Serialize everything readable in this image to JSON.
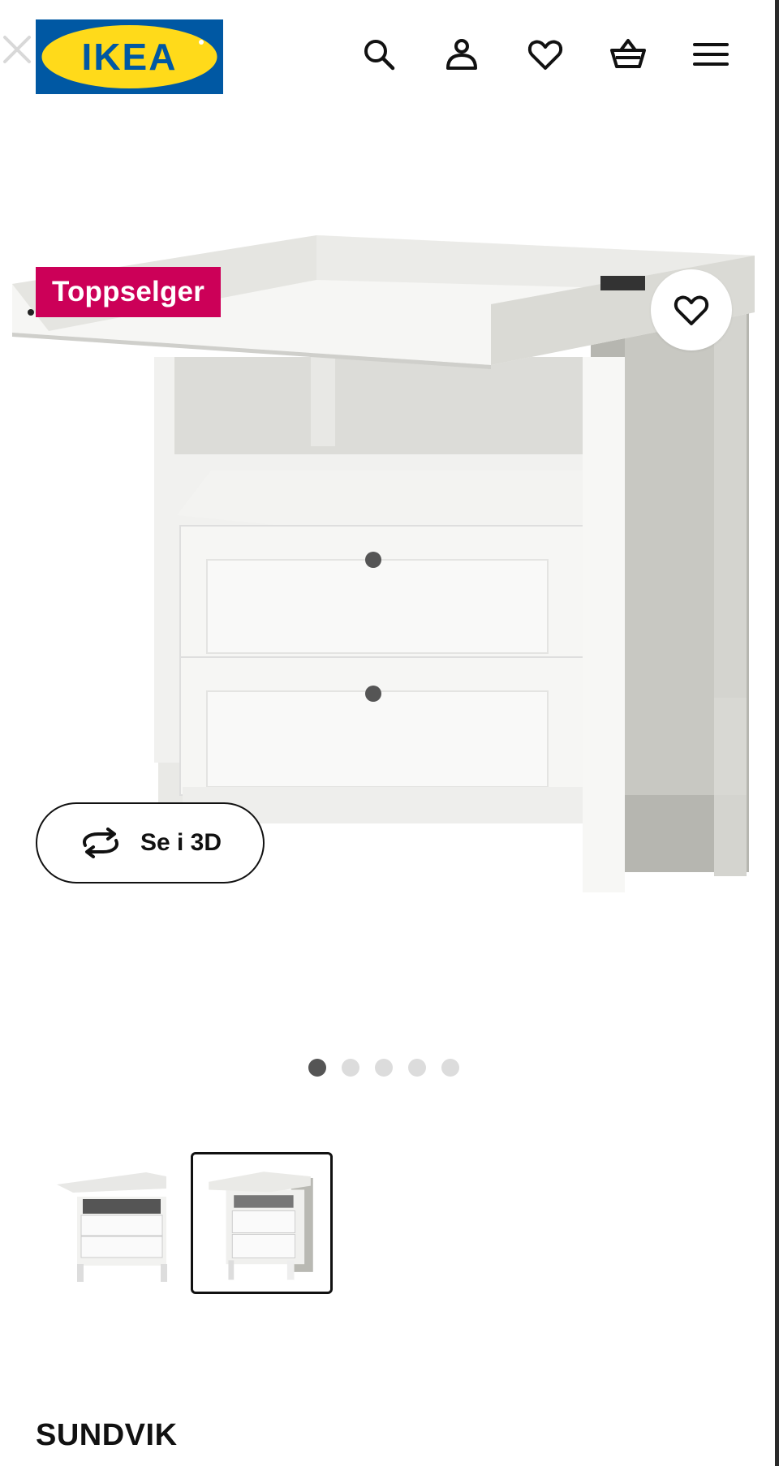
{
  "header": {
    "logo_text": "IKEA",
    "icons": [
      "close-icon",
      "search-icon",
      "account-icon",
      "heart-icon",
      "basket-icon",
      "menu-icon"
    ],
    "logo_colors": {
      "blue": "#0058a3",
      "yellow": "#ffda1a"
    }
  },
  "product": {
    "badge": "Toppselger",
    "badge_color": "#cc0058",
    "view_3d_label": "Se i 3D",
    "name": "SUNDVIK",
    "image_count": 5,
    "active_image": 1,
    "thumbnails": [
      {
        "selected": false
      },
      {
        "selected": true
      }
    ]
  }
}
